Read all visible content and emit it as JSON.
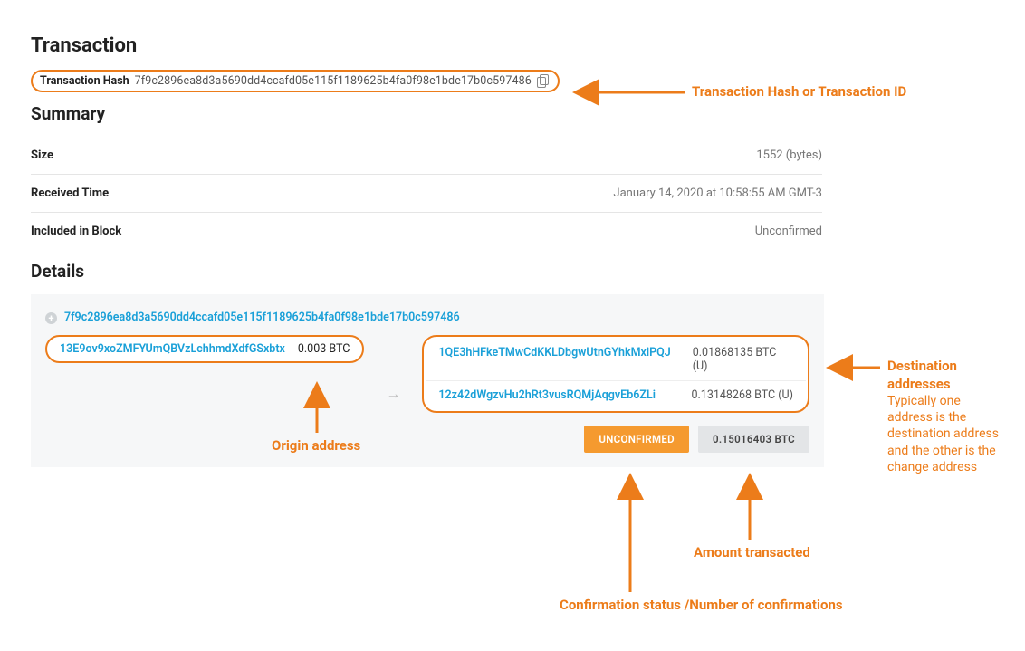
{
  "page_title": "Transaction",
  "tx_hash_label": "Transaction Hash",
  "tx_hash": "7f9c2896ea8d3a5690dd4ccafd05e115f1189625b4fa0f98e1bde17b0c597486",
  "summary_title": "Summary",
  "summary_rows": {
    "size_label": "Size",
    "size_value": "1552 (bytes)",
    "received_label": "Received Time",
    "received_value": "January 14, 2020 at 10:58:55 AM GMT-3",
    "block_label": "Included in Block",
    "block_value": "Unconfirmed"
  },
  "details_title": "Details",
  "details_hash": "7f9c2896ea8d3a5690dd4ccafd05e115f1189625b4fa0f98e1bde17b0c597486",
  "input": {
    "address": "13E9ov9xoZMFYUmQBVzLchhmdXdfGSxbtx",
    "amount": "0.003 BTC"
  },
  "outputs": [
    {
      "address": "1QE3hHFkeTMwCdKKLDbgwUtnGYhkMxiPQJ",
      "amount": "0.01868135 BTC (U)"
    },
    {
      "address": "12z42dWgzvHu2hRt3vusRQMjAqgvEb6ZLi",
      "amount": "0.13148268 BTC (U)"
    }
  ],
  "status_button": "UNCONFIRMED",
  "total_button": "0.15016403 BTC",
  "annotations": {
    "hash": "Transaction Hash or Transaction ID",
    "origin": "Origin address",
    "dest_title": "Destination addresses",
    "dest_sub": "Typically one address is the destination address and the other is the change address",
    "status": "Confirmation status /Number of confirmations",
    "amount": "Amount transacted"
  }
}
